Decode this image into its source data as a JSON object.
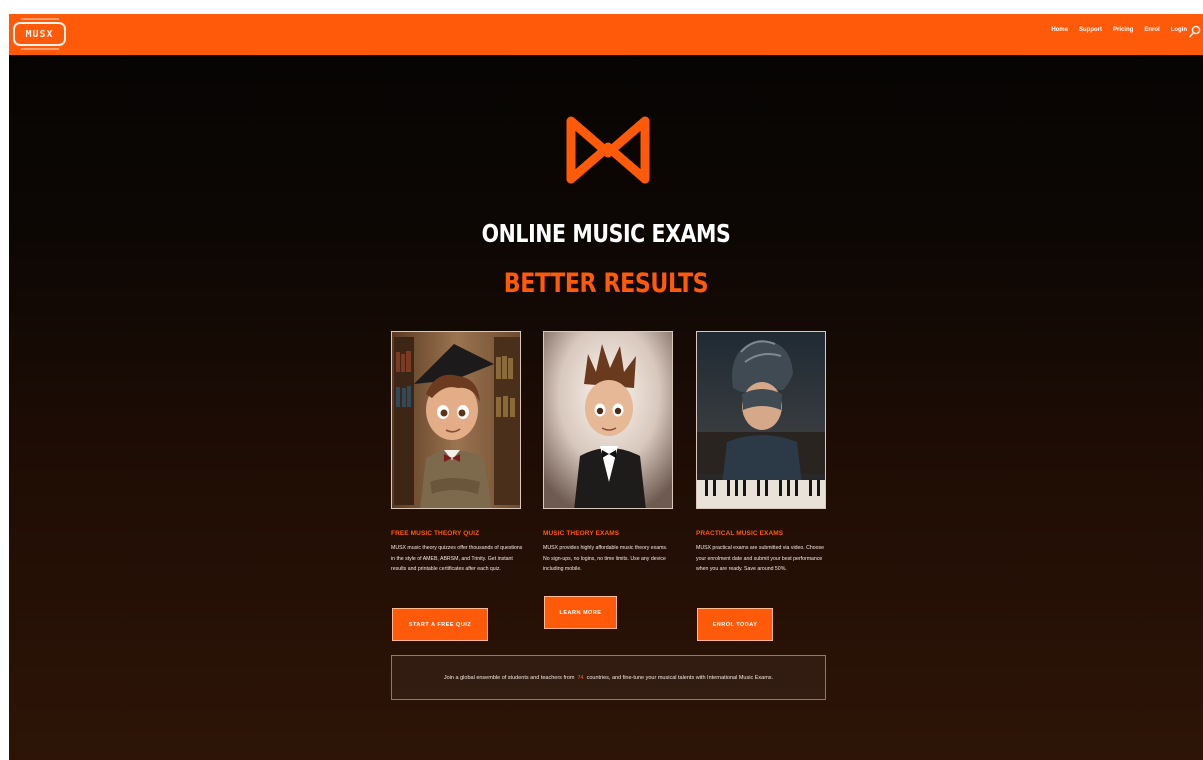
{
  "nav": {
    "logo_text": "MUSX",
    "links": [
      "Home",
      "Support",
      "Pricing",
      "Enrol",
      "Login"
    ],
    "search_icon": "search-icon"
  },
  "hero": {
    "logo_icon": "musx-m-logo",
    "headline": "ONLINE MUSIC EXAMS",
    "subheadline": "BETTER RESULTS"
  },
  "cards": [
    {
      "title": "FREE MUSIC THEORY QUIZ",
      "description": "MUSX music theory quizzes offer thousands of questions in the style of AMEB, ABRSM, and Trinity. Get instant results and printable certificates after each quiz.",
      "button": "START A FREE QUIZ",
      "image": "cartoon-student-graduate-cap-library"
    },
    {
      "title": "MUSIC THEORY EXAMS",
      "description": "MUSX provides highly affordable music theory exams. No sign-ups, no logins, no time limits. Use any device including mobile.",
      "button": "LEARN MORE",
      "image": "cartoon-boy-tuxedo-spotlight"
    },
    {
      "title": "PRACTICAL MUSIC EXAMS",
      "description": "MUSX practical exams are submitted via video. Choose your enrolment date and submit your best performance when you are ready. Save around 50%.",
      "button": "ENROL TODAY",
      "image": "cartoon-boy-back-view-piano"
    }
  ],
  "banner": {
    "prefix": "Join a global ensemble of students and teachers from",
    "count": "74",
    "suffix": "countries, and fine-tune your musical talents with International Music Exams."
  },
  "colors": {
    "accent": "#ff5a0a",
    "background_top": "#050403",
    "background_bottom": "#2d1406"
  }
}
